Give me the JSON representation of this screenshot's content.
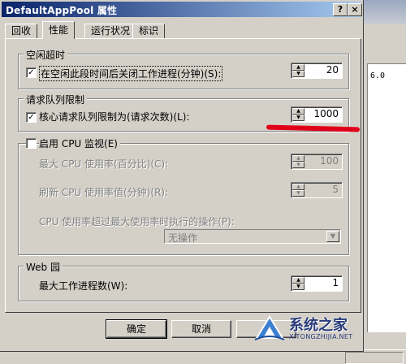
{
  "window": {
    "title": "DefaultAppPool 属性",
    "help_button": "?",
    "close_button": "×"
  },
  "tabs": [
    {
      "label": "回收"
    },
    {
      "label": "性能"
    },
    {
      "label": "运行状况"
    },
    {
      "label": "标识"
    }
  ],
  "idle_timeout": {
    "legend": "空闲超时",
    "checkbox_label": "在空闲此段时间后关闭工作进程(分钟)(S):",
    "checked": true,
    "value": "20"
  },
  "request_queue": {
    "legend": "请求队列限制",
    "checkbox_label": "核心请求队列限制为(请求次数)(L):",
    "checked": true,
    "value": "1000"
  },
  "cpu_monitor": {
    "checkbox_label": "启用 CPU 监视(E)",
    "checked": false,
    "max_cpu_label": "最大 CPU 使用率(百分比)(C):",
    "max_cpu_value": "100",
    "refresh_label": "刷新 CPU 使用率值(分钟)(R):",
    "refresh_value": "5",
    "action_label": "CPU 使用率超过最大使用率时执行的操作(P):",
    "action_value": "无操作"
  },
  "web_garden": {
    "legend": "Web 园",
    "max_workers_label": "最大工作进程数(W):",
    "max_workers_value": "1"
  },
  "buttons": {
    "ok": "确定",
    "cancel": "取消"
  },
  "background_window": {
    "list_text": "6.0"
  },
  "watermark": {
    "name": "系统之家",
    "url": "XITONGZHIJIA.NET"
  },
  "colors": {
    "title_gradient_start": "#0a246a",
    "title_gradient_end": "#a6caf0",
    "annotation_red": "#e0001a",
    "dialog_face": "#d4d0c8"
  }
}
